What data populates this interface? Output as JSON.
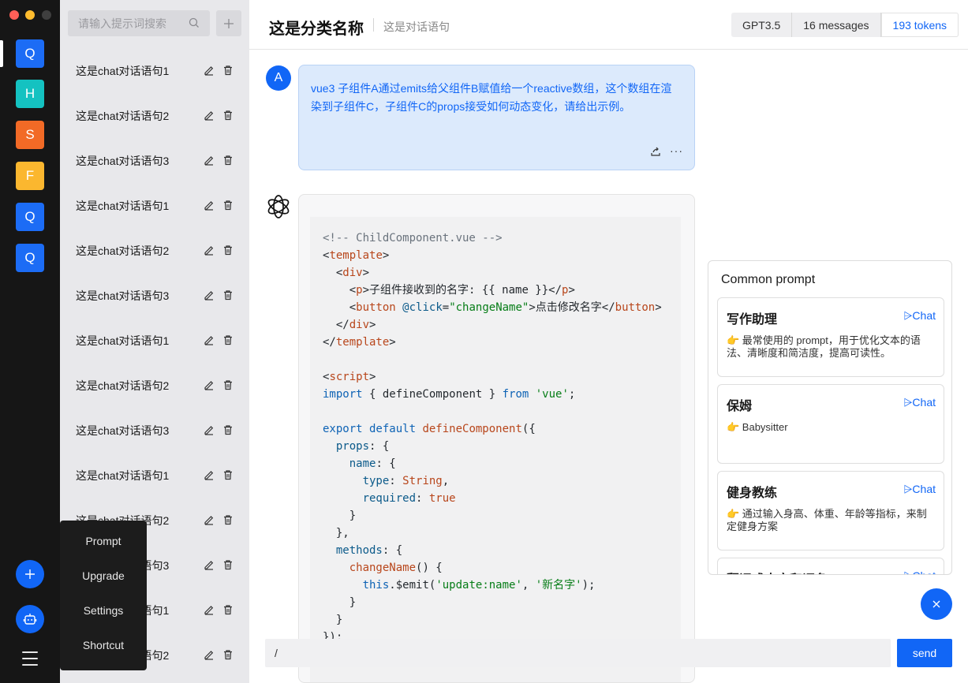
{
  "rail": {
    "workspaces": [
      {
        "letter": "Q",
        "color": "#1c6cf5"
      },
      {
        "letter": "H",
        "color": "#14c2c1"
      },
      {
        "letter": "S",
        "color": "#f26a26"
      },
      {
        "letter": "F",
        "color": "#fbb72f"
      },
      {
        "letter": "Q",
        "color": "#1c6cf5"
      },
      {
        "letter": "Q",
        "color": "#1c6cf5"
      }
    ]
  },
  "sidebar": {
    "search_placeholder": "请输入提示词搜索",
    "conversations": [
      "这是chat对话语句1",
      "这是chat对话语句2",
      "这是chat对话语句3",
      "这是chat对话语句1",
      "这是chat对话语句2",
      "这是chat对话语句3",
      "这是chat对话语句1",
      "这是chat对话语句2",
      "这是chat对话语句3",
      "这是chat对话语句1",
      "这是chat对话语句2",
      "这是chat对话语句3",
      "这是chat对话语句1",
      "这是chat对话语句2"
    ]
  },
  "menu": {
    "items": [
      "Prompt",
      "Upgrade",
      "Settings",
      "Shortcut"
    ]
  },
  "header": {
    "title": "这是分类名称",
    "subtitle": "这是对话语句",
    "model": "GPT3.5",
    "messages": "16 messages",
    "tokens": "193 tokens"
  },
  "chat": {
    "user_avatar": "A",
    "user_message": "vue3 子组件A通过emits给父组件B赋值给一个reactive数组，这个数组在渲染到子组件C，子组件C的props接受如何动态变化，请给出示例。",
    "more_label": "···"
  },
  "input": {
    "value": "/",
    "send_label": "send"
  },
  "prompt_panel": {
    "title": "Common prompt",
    "chat_label": "⩥Chat",
    "cards": [
      {
        "title": "写作助理",
        "desc": "👉 最常使用的 prompt，用于优化文本的语法、清晰度和简洁度，提高可读性。"
      },
      {
        "title": "保姆",
        "desc": "👉 Babysitter"
      },
      {
        "title": "健身教练",
        "desc": "👉 通过输入身高、体重、年龄等指标，来制定健身方案"
      },
      {
        "title": "翻译成中文和词条",
        "desc": ""
      }
    ]
  },
  "colors": {
    "accent": "#1166f6",
    "rail_bg": "#161616",
    "list_bg": "#e8e8eb",
    "user_bubble_bg": "#dceafc"
  }
}
